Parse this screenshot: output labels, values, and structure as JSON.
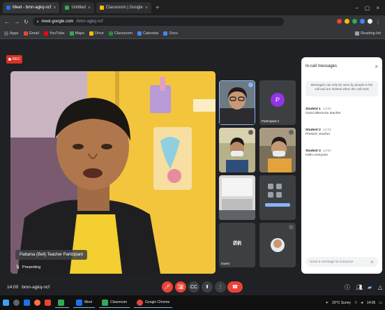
{
  "browser": {
    "tabs": [
      {
        "label": "Meet - bmn-agkq-ncf",
        "color": "#1a73e8",
        "active": true
      },
      {
        "label": "Untitled",
        "color": "#34a853",
        "active": false
      },
      {
        "label": "Classroom | Google",
        "color": "#fbbc04",
        "active": false
      }
    ],
    "url_host": "meet.google.com",
    "url_path": "/bmn-agkq-ncf",
    "bookmarks": [
      {
        "label": "Apps",
        "color": "#5f6368"
      },
      {
        "label": "Gmail",
        "color": "#ea4335"
      },
      {
        "label": "YouTube",
        "color": "#ff0000"
      },
      {
        "label": "Maps",
        "color": "#34a853"
      },
      {
        "label": "Drive",
        "color": "#fbbc04"
      },
      {
        "label": "Classroom",
        "color": "#1e8e3e"
      },
      {
        "label": "Calendar",
        "color": "#4285f4"
      },
      {
        "label": "Docs",
        "color": "#4285f4"
      },
      {
        "label": "Reading list",
        "color": "#9aa0a6"
      }
    ]
  },
  "meet": {
    "recording_label": "REC",
    "speaker_name": "Pattama (Bell) Teacher Participant",
    "speaker_sub": "Presenting",
    "participants": [
      {
        "name": "",
        "kind": "woman-glasses"
      },
      {
        "name": "Participant 2",
        "kind": "avatar-p"
      },
      {
        "name": "",
        "kind": "man-mask"
      },
      {
        "name": "",
        "kind": "woman-mask"
      },
      {
        "name": "",
        "kind": "screen-share"
      },
      {
        "name": "",
        "kind": "avatar-grid"
      },
      {
        "name": "Guest",
        "kind": "avatar-text"
      },
      {
        "name": "",
        "kind": "avatar-round"
      }
    ],
    "meeting_time": "14:00",
    "meeting_code": "bmn-agkq-ncf"
  },
  "chat": {
    "title": "In-call messages",
    "notice": "Messages can only be seen by people in the call and are deleted when the call ends",
    "messages": [
      {
        "sender": "Student 1",
        "time": "14:01",
        "text": "Good afternoon teacher"
      },
      {
        "sender": "Student 2",
        "time": "14:02",
        "text": "Present, teacher"
      },
      {
        "sender": "Student 3",
        "time": "14:02",
        "text": "Hello everyone"
      }
    ],
    "input_placeholder": "Send a message to everyone"
  },
  "taskbar": {
    "apps": [
      {
        "label": "",
        "color": "#f4c20d"
      },
      {
        "label": "Meet",
        "color": "#1a73e8"
      },
      {
        "label": "Classroom",
        "color": "#34a853"
      },
      {
        "label": "Google Chrome",
        "color": "#ea4335"
      }
    ],
    "tray_text": "29°C Sunny",
    "clock": "14:05"
  },
  "colors": {
    "accent": "#8ab4f8",
    "danger": "#ea4335",
    "panel": "#ffffff"
  }
}
